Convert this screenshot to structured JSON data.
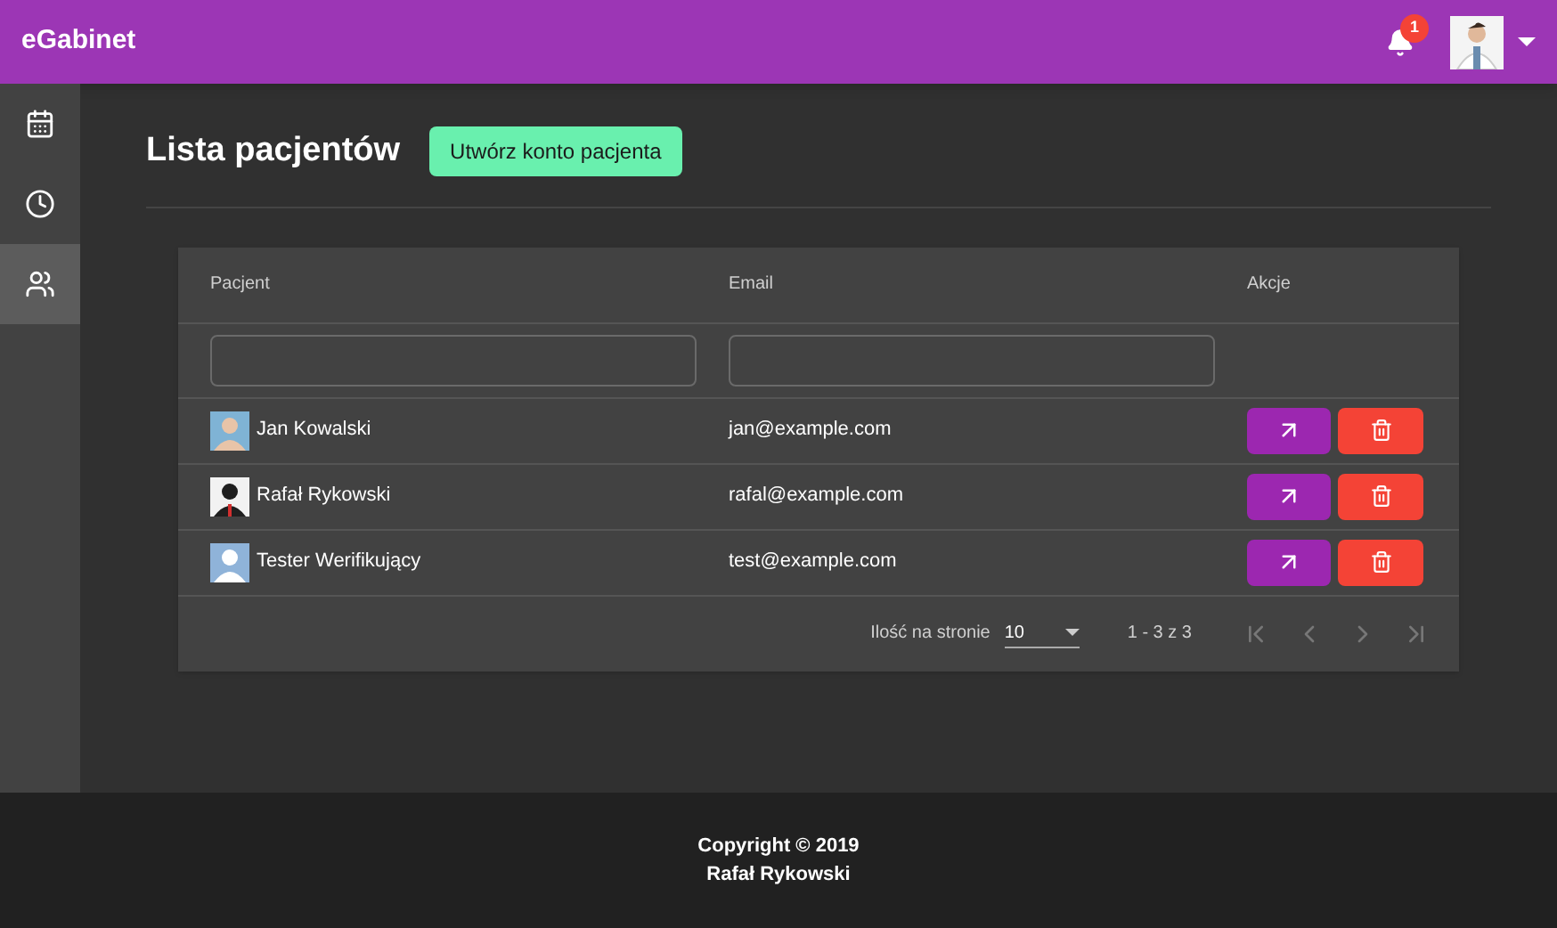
{
  "app_bar": {
    "title": "eGabinet",
    "notifications": "1"
  },
  "sidebar": {
    "items": [
      {
        "kind": "calendar",
        "selected": false
      },
      {
        "kind": "clock",
        "selected": false
      },
      {
        "kind": "people",
        "selected": true
      }
    ]
  },
  "page": {
    "title": "Lista pacjentów",
    "create_button": "Utwórz konto pacjenta"
  },
  "table": {
    "columns": [
      "Pacjent",
      "Email",
      "Akcje"
    ],
    "filters": [
      {
        "kind": "text"
      },
      {
        "kind": "text"
      }
    ],
    "rows": [
      {
        "name": "Jan Kowalski",
        "email": "jan@example.com"
      },
      {
        "name": "Rafał Rykowski",
        "email": "rafal@example.com"
      },
      {
        "name": "Tester Werifikujący",
        "email": "test@example.com"
      }
    ],
    "paginator": {
      "label": "Ilość na stronie",
      "page_size": "10",
      "range": "1 - 3 z 3",
      "buttons": [
        {
          "kind": "first",
          "disabled": true
        },
        {
          "kind": "prev",
          "disabled": true
        },
        {
          "kind": "next",
          "disabled": true
        },
        {
          "kind": "last",
          "disabled": true
        }
      ]
    }
  },
  "footer": {
    "lines": [
      "Copyright © 2019",
      "Rafał Rykowski"
    ]
  }
}
